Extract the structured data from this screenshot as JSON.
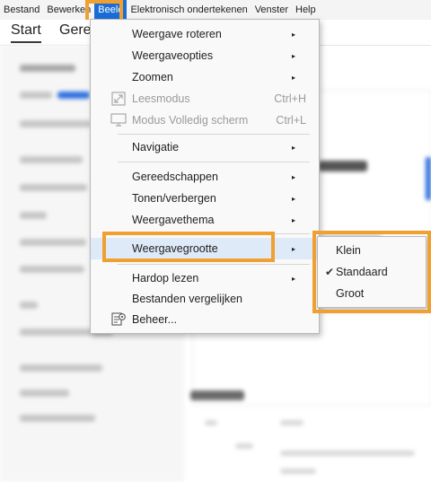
{
  "menubar": {
    "items": [
      "Bestand",
      "Bewerken",
      "Beeld",
      "Elektronisch ondertekenen",
      "Venster",
      "Help"
    ],
    "active": "Beeld"
  },
  "tabs": {
    "start": "Start",
    "partial": "Geree"
  },
  "view_menu": {
    "rotate": {
      "label": "Weergave roteren",
      "arrow": "▸"
    },
    "options": {
      "label": "Weergaveopties",
      "arrow": "▸"
    },
    "zoom": {
      "label": "Zoomen",
      "arrow": "▸"
    },
    "read_mode": {
      "label": "Leesmodus",
      "shortcut": "Ctrl+H",
      "icon": "read-mode-icon",
      "disabled": true
    },
    "full_screen": {
      "label": "Modus Volledig scherm",
      "shortcut": "Ctrl+L",
      "icon": "monitor-icon",
      "disabled": true
    },
    "navigation": {
      "label": "Navigatie",
      "arrow": "▸"
    },
    "tools": {
      "label": "Gereedschappen",
      "arrow": "▸"
    },
    "show_hide": {
      "label": "Tonen/verbergen",
      "arrow": "▸"
    },
    "theme": {
      "label": "Weergavethema",
      "arrow": "▸"
    },
    "size": {
      "label": "Weergavegrootte",
      "arrow": "▸",
      "highlighted": true
    },
    "read_aloud": {
      "label": "Hardop lezen",
      "arrow": "▸"
    },
    "compare": {
      "label": "Bestanden vergelijken"
    },
    "manage": {
      "label": "Beheer...",
      "icon": "manage-icon"
    }
  },
  "size_submenu": {
    "small": "Klein",
    "standard": "Standaard",
    "large": "Groot",
    "selected": "Standaard",
    "check": "✔"
  },
  "colors": {
    "highlight": "#f0a030",
    "menubar_active": "#1a6dd6"
  }
}
